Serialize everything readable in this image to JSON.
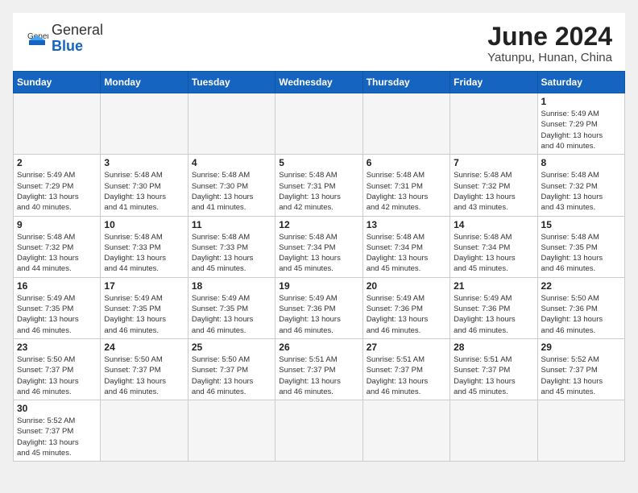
{
  "header": {
    "logo_general": "General",
    "logo_blue": "Blue",
    "month_title": "June 2024",
    "location": "Yatunpu, Hunan, China"
  },
  "days_of_week": [
    "Sunday",
    "Monday",
    "Tuesday",
    "Wednesday",
    "Thursday",
    "Friday",
    "Saturday"
  ],
  "weeks": [
    [
      {
        "day": "",
        "info": ""
      },
      {
        "day": "",
        "info": ""
      },
      {
        "day": "",
        "info": ""
      },
      {
        "day": "",
        "info": ""
      },
      {
        "day": "",
        "info": ""
      },
      {
        "day": "",
        "info": ""
      },
      {
        "day": "1",
        "info": "Sunrise: 5:49 AM\nSunset: 7:29 PM\nDaylight: 13 hours\nand 40 minutes."
      }
    ],
    [
      {
        "day": "2",
        "info": "Sunrise: 5:49 AM\nSunset: 7:29 PM\nDaylight: 13 hours\nand 40 minutes."
      },
      {
        "day": "3",
        "info": "Sunrise: 5:48 AM\nSunset: 7:30 PM\nDaylight: 13 hours\nand 41 minutes."
      },
      {
        "day": "4",
        "info": "Sunrise: 5:48 AM\nSunset: 7:30 PM\nDaylight: 13 hours\nand 41 minutes."
      },
      {
        "day": "5",
        "info": "Sunrise: 5:48 AM\nSunset: 7:31 PM\nDaylight: 13 hours\nand 42 minutes."
      },
      {
        "day": "6",
        "info": "Sunrise: 5:48 AM\nSunset: 7:31 PM\nDaylight: 13 hours\nand 42 minutes."
      },
      {
        "day": "7",
        "info": "Sunrise: 5:48 AM\nSunset: 7:32 PM\nDaylight: 13 hours\nand 43 minutes."
      },
      {
        "day": "8",
        "info": "Sunrise: 5:48 AM\nSunset: 7:32 PM\nDaylight: 13 hours\nand 43 minutes."
      }
    ],
    [
      {
        "day": "9",
        "info": "Sunrise: 5:48 AM\nSunset: 7:32 PM\nDaylight: 13 hours\nand 44 minutes."
      },
      {
        "day": "10",
        "info": "Sunrise: 5:48 AM\nSunset: 7:33 PM\nDaylight: 13 hours\nand 44 minutes."
      },
      {
        "day": "11",
        "info": "Sunrise: 5:48 AM\nSunset: 7:33 PM\nDaylight: 13 hours\nand 45 minutes."
      },
      {
        "day": "12",
        "info": "Sunrise: 5:48 AM\nSunset: 7:34 PM\nDaylight: 13 hours\nand 45 minutes."
      },
      {
        "day": "13",
        "info": "Sunrise: 5:48 AM\nSunset: 7:34 PM\nDaylight: 13 hours\nand 45 minutes."
      },
      {
        "day": "14",
        "info": "Sunrise: 5:48 AM\nSunset: 7:34 PM\nDaylight: 13 hours\nand 45 minutes."
      },
      {
        "day": "15",
        "info": "Sunrise: 5:48 AM\nSunset: 7:35 PM\nDaylight: 13 hours\nand 46 minutes."
      }
    ],
    [
      {
        "day": "16",
        "info": "Sunrise: 5:49 AM\nSunset: 7:35 PM\nDaylight: 13 hours\nand 46 minutes."
      },
      {
        "day": "17",
        "info": "Sunrise: 5:49 AM\nSunset: 7:35 PM\nDaylight: 13 hours\nand 46 minutes."
      },
      {
        "day": "18",
        "info": "Sunrise: 5:49 AM\nSunset: 7:35 PM\nDaylight: 13 hours\nand 46 minutes."
      },
      {
        "day": "19",
        "info": "Sunrise: 5:49 AM\nSunset: 7:36 PM\nDaylight: 13 hours\nand 46 minutes."
      },
      {
        "day": "20",
        "info": "Sunrise: 5:49 AM\nSunset: 7:36 PM\nDaylight: 13 hours\nand 46 minutes."
      },
      {
        "day": "21",
        "info": "Sunrise: 5:49 AM\nSunset: 7:36 PM\nDaylight: 13 hours\nand 46 minutes."
      },
      {
        "day": "22",
        "info": "Sunrise: 5:50 AM\nSunset: 7:36 PM\nDaylight: 13 hours\nand 46 minutes."
      }
    ],
    [
      {
        "day": "23",
        "info": "Sunrise: 5:50 AM\nSunset: 7:37 PM\nDaylight: 13 hours\nand 46 minutes."
      },
      {
        "day": "24",
        "info": "Sunrise: 5:50 AM\nSunset: 7:37 PM\nDaylight: 13 hours\nand 46 minutes."
      },
      {
        "day": "25",
        "info": "Sunrise: 5:50 AM\nSunset: 7:37 PM\nDaylight: 13 hours\nand 46 minutes."
      },
      {
        "day": "26",
        "info": "Sunrise: 5:51 AM\nSunset: 7:37 PM\nDaylight: 13 hours\nand 46 minutes."
      },
      {
        "day": "27",
        "info": "Sunrise: 5:51 AM\nSunset: 7:37 PM\nDaylight: 13 hours\nand 46 minutes."
      },
      {
        "day": "28",
        "info": "Sunrise: 5:51 AM\nSunset: 7:37 PM\nDaylight: 13 hours\nand 45 minutes."
      },
      {
        "day": "29",
        "info": "Sunrise: 5:52 AM\nSunset: 7:37 PM\nDaylight: 13 hours\nand 45 minutes."
      }
    ],
    [
      {
        "day": "30",
        "info": "Sunrise: 5:52 AM\nSunset: 7:37 PM\nDaylight: 13 hours\nand 45 minutes."
      },
      {
        "day": "",
        "info": ""
      },
      {
        "day": "",
        "info": ""
      },
      {
        "day": "",
        "info": ""
      },
      {
        "day": "",
        "info": ""
      },
      {
        "day": "",
        "info": ""
      },
      {
        "day": "",
        "info": ""
      }
    ]
  ]
}
